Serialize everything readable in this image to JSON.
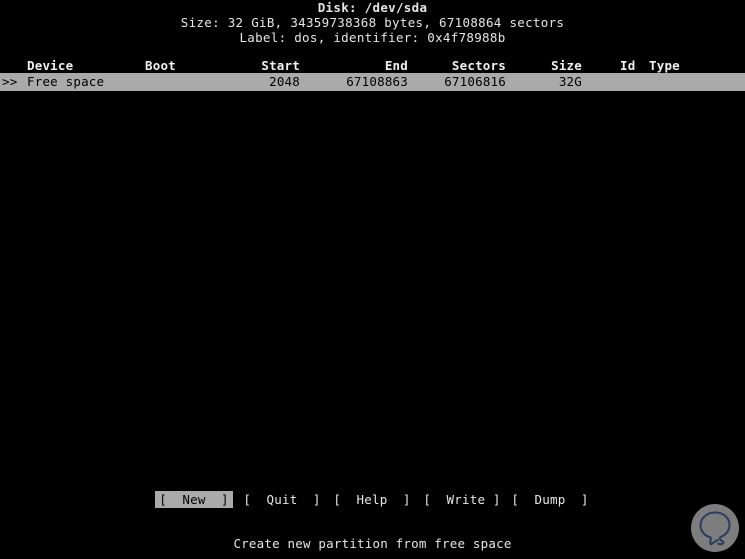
{
  "header": {
    "disk_line": "Disk: /dev/sda",
    "size_line": "Size: 32 GiB, 34359738368 bytes, 67108864 sectors",
    "label_line": "Label: dos, identifier: 0x4f78988b"
  },
  "table": {
    "columns": [
      {
        "key": "device",
        "label": "Device"
      },
      {
        "key": "boot",
        "label": "Boot"
      },
      {
        "key": "start",
        "label": "Start"
      },
      {
        "key": "end",
        "label": "End"
      },
      {
        "key": "sectors",
        "label": "Sectors"
      },
      {
        "key": "size",
        "label": "Size"
      },
      {
        "key": "id",
        "label": "Id"
      },
      {
        "key": "type",
        "label": "Type"
      }
    ],
    "rows": [
      {
        "marker": ">>",
        "device": "Free space",
        "boot": "",
        "start": "2048",
        "end": "67108863",
        "sectors": "67106816",
        "size": "32G",
        "id": "",
        "type": "",
        "selected": true
      }
    ]
  },
  "menu": {
    "buttons": [
      {
        "label": "[  New  ]",
        "name": "new",
        "selected": true
      },
      {
        "label": "[  Quit  ]",
        "name": "quit",
        "selected": false
      },
      {
        "label": "[  Help  ]",
        "name": "help",
        "selected": false
      },
      {
        "label": "[  Write ]",
        "name": "write",
        "selected": false
      },
      {
        "label": "[  Dump  ]",
        "name": "dump",
        "selected": false
      }
    ]
  },
  "status": {
    "text": "Create new partition from free space"
  },
  "colors": {
    "background": "#000000",
    "foreground": "#e6e6e6",
    "highlight_bg": "#aaaaaa",
    "highlight_fg": "#000000",
    "watermark_glyph": "#2c3d5e"
  },
  "watermark": {
    "icon": "speech-bubble-logo"
  }
}
